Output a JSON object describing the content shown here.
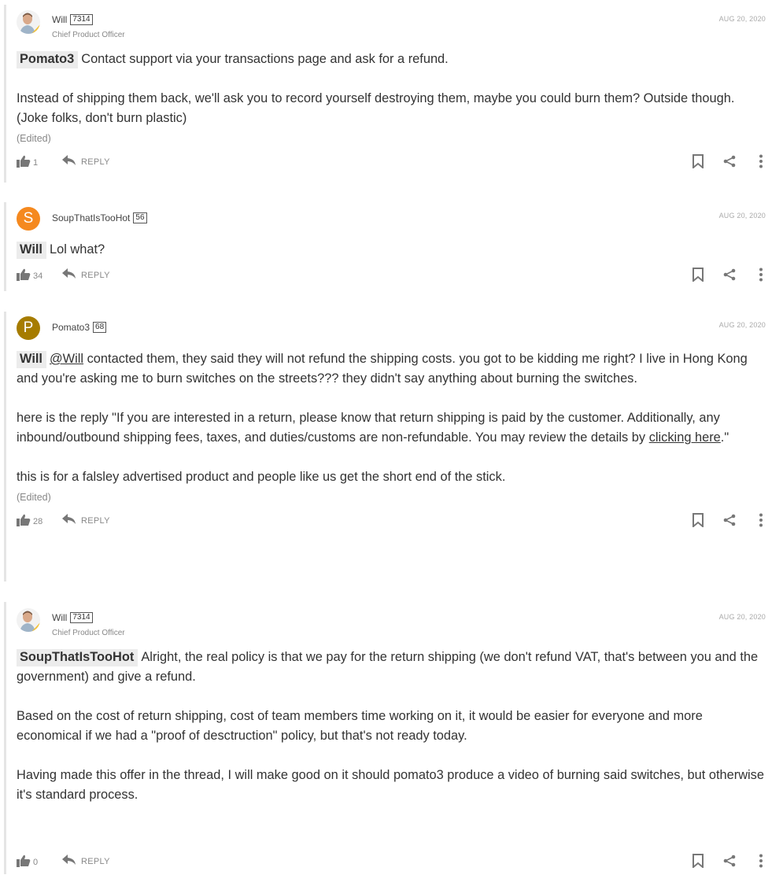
{
  "comments": [
    {
      "author": "Will",
      "rep": "7314",
      "title": "Chief Product Officer",
      "date": "AUG 20, 2020",
      "mention": "Pomato3",
      "line1": "Contact support via your transactions page and ask for a refund.",
      "para2": "Instead of shipping them back, we'll ask you to record yourself destroying them, maybe you could burn them? Outside though. (Joke folks, don't burn plastic)",
      "edited": "(Edited)",
      "likes": "1",
      "reply_label": "REPLY"
    },
    {
      "author": "SoupThatIsTooHot",
      "rep": "56",
      "avatar_letter": "S",
      "date": "AUG 20, 2020",
      "mention": "Will",
      "line1": "Lol what?",
      "likes": "34",
      "reply_label": "REPLY"
    },
    {
      "author": "Pomato3",
      "rep": "68",
      "avatar_letter": "P",
      "date": "AUG 20, 2020",
      "mention": "Will",
      "at_mention": "@Will",
      "line1": "contacted them, they said they will not refund the shipping costs. you got to be kidding me right? I live in Hong Kong and you're asking me to burn switches on the streets??? they didn't say anything about burning the switches.",
      "para2_a": "here is the reply \"If you are interested in a return, please know that return shipping is paid by the customer. Additionally, any inbound/outbound shipping fees, taxes, and duties/customs are non-refundable. You may review the details by",
      "para2_link": "clicking here",
      "para2_b": ".\"",
      "para3": "this is for a falsley advertised product and people like us get the short end of the stick.",
      "edited": "(Edited)",
      "likes": "28",
      "reply_label": "REPLY"
    },
    {
      "author": "Will",
      "rep": "7314",
      "title": "Chief Product Officer",
      "date": "AUG 20, 2020",
      "mention": "SoupThatIsTooHot",
      "line1": "Alright, the real policy is that we pay for the return shipping (we don't refund VAT, that's between you and the government) and give a refund.",
      "para2": "Based on the cost of return shipping, cost of team members time working on it, it would be easier for everyone and more economical if we had a \"proof of desctruction\" policy, but that's not ready today.",
      "para3": "Having made this offer in the thread, I will make good on it should pomato3 produce a video of burning said switches, but otherwise it's standard process.",
      "likes": "0",
      "reply_label": "REPLY"
    }
  ],
  "colors": {
    "soup_avatar": "#f5891f",
    "pomato_avatar": "#a67c00",
    "icon": "#777777"
  },
  "icons": [
    "thumbs-up-icon",
    "reply-arrow-icon",
    "bookmark-icon",
    "share-icon",
    "more-vertical-icon"
  ]
}
